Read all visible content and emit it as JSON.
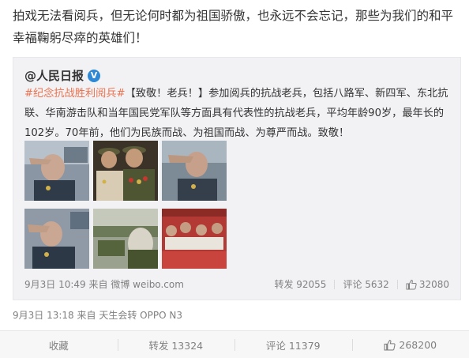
{
  "post": {
    "text": "拍戏无法看阅兵，但无论何时都为祖国骄傲，也永远不会忘记，那些为我们的和平幸福鞠躬尽瘁的英雄们！",
    "timestamp": "9月3日 13:18",
    "from_label": "来自",
    "source": "天生会转 OPPO N3"
  },
  "original": {
    "author": "@人民日报",
    "verified_badge": "V",
    "hashtag": "#纪念抗战胜利阅兵#",
    "text": "【致敬！老兵！】参加阅兵的抗战老兵，包括八路军、新四军、东北抗联、华南游击队和当年国民党军队等方面具有代表性的抗战老兵，平均年龄90岁，最年长的102岁。70年前，他们为民族而战、为祖国而战、为尊严而战。致敬！",
    "timestamp": "9月3日 10:49",
    "from_label": "来自",
    "source": "微博 weibo.com",
    "repost": "转发 92055",
    "comment": "评论 5632",
    "likes": "32080",
    "photos": [
      {
        "name": "veteran-salute-photo-1"
      },
      {
        "name": "veterans-group-photo"
      },
      {
        "name": "veteran-salute-photo-2"
      },
      {
        "name": "veteran-salute-photo-3"
      },
      {
        "name": "parade-vehicle-photo"
      },
      {
        "name": "parade-crowd-photo"
      }
    ]
  },
  "actions": {
    "favorite": "收藏",
    "repost": "转发 13324",
    "comment": "评论 11379",
    "likes": "268200"
  },
  "colors": {
    "hashtag": "#eb7350",
    "verified": "#2d88d6",
    "meta_gray": "#808080",
    "repost_bg": "#f2f2f5"
  }
}
